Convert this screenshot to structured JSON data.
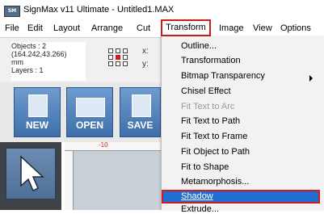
{
  "titlebar": {
    "app_icon": "signmax-icon",
    "title": "SignMax v11 Ultimate - Untitled1.MAX"
  },
  "menubar": {
    "items": [
      "File",
      "Edit",
      "Layout",
      "Arrange",
      "Cut",
      "Transform",
      "Image",
      "View",
      "Options"
    ]
  },
  "info": {
    "objects": "Objects : 2",
    "coords": "(164.242,43.266)",
    "units": "mm",
    "layers": "Layers : 1"
  },
  "coord_labels": {
    "x": "x:",
    "y": "y:"
  },
  "buttons": {
    "new": "NEW",
    "open": "OPEN",
    "save": "SAVE"
  },
  "ruler": {
    "label": "-10"
  },
  "dropdown": {
    "items": [
      {
        "label": "Outline...",
        "disabled": false
      },
      {
        "label": "Transformation",
        "disabled": false
      },
      {
        "label": "Bitmap Transparency",
        "disabled": false,
        "submenu": true
      },
      {
        "label": "Chisel Effect",
        "disabled": false
      },
      {
        "label": "Fit Text to Arc",
        "disabled": true
      },
      {
        "label": "Fit Text to Path",
        "disabled": false
      },
      {
        "label": "Fit Text to Frame",
        "disabled": false
      },
      {
        "label": "Fit Object to Path",
        "disabled": false
      },
      {
        "label": "Fit to Shape",
        "disabled": false
      },
      {
        "label": "Metamorphosis...",
        "disabled": false
      },
      {
        "label": "Shadow",
        "disabled": false,
        "highlighted": true
      },
      {
        "label": "Extrude...",
        "disabled": false
      }
    ]
  },
  "colors": {
    "highlight": "#1e6fd1",
    "annotation": "#d11a1a",
    "button_blue": "#3e6fa8"
  }
}
